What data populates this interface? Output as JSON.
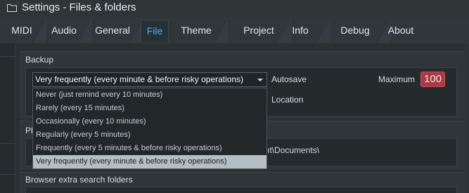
{
  "window": {
    "title": "Settings - Files & folders",
    "icon": "folder-icon"
  },
  "tabs": [
    {
      "label": "MIDI",
      "active": false
    },
    {
      "label": "Audio",
      "active": false
    },
    {
      "label": "General",
      "active": false
    },
    {
      "label": "File",
      "active": true
    },
    {
      "label": "Theme",
      "active": false
    },
    {
      "label": "Project",
      "active": false
    },
    {
      "label": "Info",
      "active": false
    },
    {
      "label": "Debug",
      "active": false
    },
    {
      "label": "About",
      "active": false
    }
  ],
  "backup": {
    "section_title": "Backup",
    "frequency_selected": "Very frequently (every minute & before risky operations)",
    "autosave_label": "Autosave",
    "maximum_label": "Maximum",
    "maximum_value": "100",
    "location_label": "Location",
    "options": [
      "Never (just remind every 10 minutes)",
      "Rarely (every 15 minutes)",
      "Occasionally (every 10 minutes)",
      "Regularly (every 5 minutes)",
      "Frequently (every 5 minutes & before risky operations)",
      "Very frequently (every minute & before risky operations)"
    ],
    "selected_index": 5
  },
  "plugins_section": {
    "title_partial": "Pl",
    "path_partial": "ıt\\Documents\\"
  },
  "browser_section": {
    "title": "Browser extra search folders"
  },
  "colors": {
    "accent_tab": "#5ea8f0",
    "maximum_box": "#a63a45",
    "selected_option": "#b5bec3"
  }
}
